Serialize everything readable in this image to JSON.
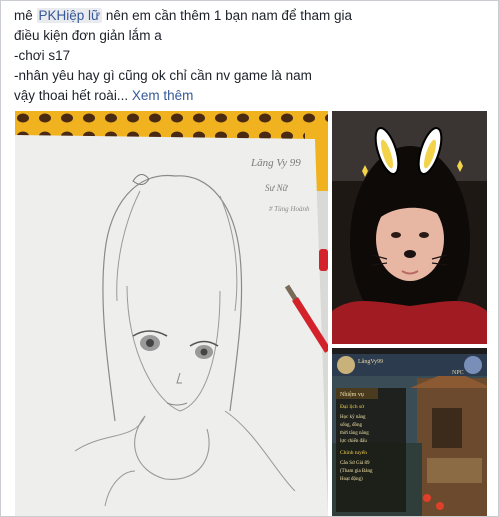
{
  "post": {
    "lines": [
      {
        "before": "mê ",
        "tag": "PKHiệp lữ",
        "after": " nên em cần thêm 1 bạn nam để tham gia"
      },
      {
        "text": "điều kiện đơn giản lắm a"
      },
      {
        "text": "-chơi s17"
      },
      {
        "text": "-nhân yêu hay gì cũng ok chỉ cần nv game là nam"
      },
      {
        "text": "vậy thoai hết roài... ",
        "see_more": "Xem thêm"
      }
    ]
  },
  "photos": {
    "drawing": {
      "signature_line1": "Lăng Vy 99",
      "signature_line2": "Sư Nữ",
      "signature_line3": "# Tùng Hoành"
    },
    "game": {
      "hud_name": "LăngVy99",
      "hud_right": "NPC",
      "quest_tab": "Nhiệm vụ",
      "quest_title": "Đại lịch sử",
      "quest_lines": [
        "Học kỹ năng",
        "sống, đồng",
        "thời tăng năng",
        "lực chiến đấu"
      ],
      "quest_section": "Chính tuyến",
      "quest_desc": [
        "Cắn Sứ Giả 89",
        "(Tham gia Bảng",
        "Hoạt động)"
      ],
      "colors": {
        "hud": "#2d3b4f",
        "accent": "#e6d9a8"
      }
    }
  }
}
